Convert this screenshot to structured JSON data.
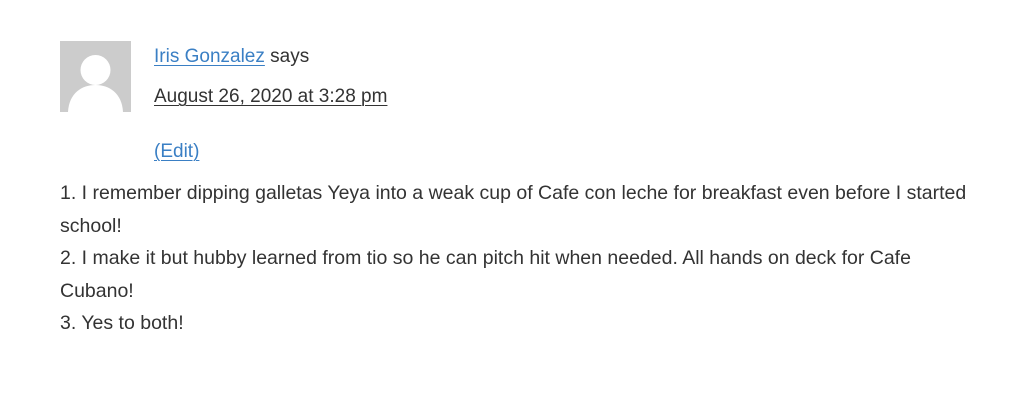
{
  "comment": {
    "author": "Iris Gonzalez",
    "says": "says",
    "date": "August 26, 2020 at 3:28 pm",
    "edit": "(Edit)",
    "avatar_icon": "default-user-avatar",
    "paragraphs": [
      "1. I remember dipping galletas Yeya into a weak cup of Cafe con leche for breakfast even before I started school!",
      "2. I make it but hubby learned from tio so he can pitch hit when needed. All hands on deck for Cafe Cubano!",
      "3. Yes to both!"
    ]
  },
  "colors": {
    "link": "#3a7fc4",
    "text": "#333333",
    "avatar_bg": "#cccccc",
    "avatar_fg": "#ffffff"
  }
}
